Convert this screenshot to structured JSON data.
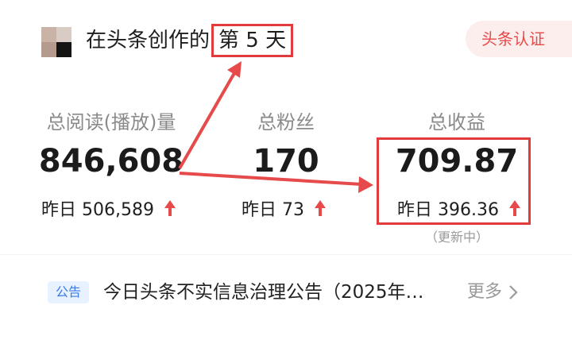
{
  "header": {
    "title_prefix": "在头条创作的",
    "title_highlight": "第 5 天",
    "verify_label": "头条认证"
  },
  "stats": [
    {
      "label": "总阅读(播放)量",
      "value": "846,608",
      "yesterday": "昨日 506,589"
    },
    {
      "label": "总粉丝",
      "value": "170",
      "yesterday": "昨日 73"
    },
    {
      "label": "总收益",
      "value": "709.87",
      "yesterday": "昨日 396.36",
      "note": "（更新中）"
    }
  ],
  "announcement": {
    "tag": "公告",
    "text": "今日头条不实信息治理公告（2025年…",
    "more_label": "更多"
  },
  "colors": {
    "accent_red": "#e23b3b",
    "arrow_red": "#e64a4a",
    "notice_blue": "#3b7ae8",
    "badge_bg": "#fdeeee"
  },
  "icons": [
    "up-arrow-icon",
    "chevron-right-icon"
  ]
}
